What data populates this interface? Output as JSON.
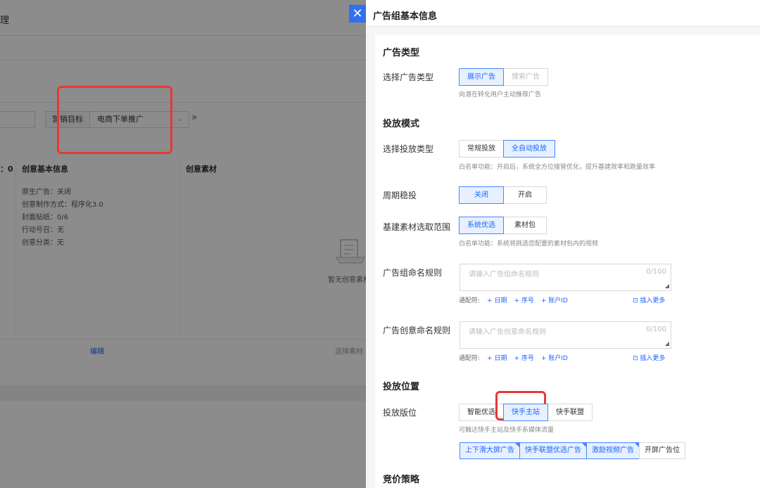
{
  "background": {
    "title_fragment": "理",
    "filter": {
      "label": "营销目标",
      "value": "电商下单推广"
    },
    "more_icon": "double-chevron-right-icon",
    "count_fragment": "：0",
    "col_basic": "创意基本信息",
    "col_material": "创意素材",
    "properties": [
      "原生广告：关闭",
      "创意制作方式：程序化3.0",
      "封面贴纸：0/6",
      "行动号召：无",
      "创意分类：无"
    ],
    "empty_text": "暂无创意素材",
    "edit_link": "编辑",
    "choose_link": "选择素材"
  },
  "drawer": {
    "title": "广告组基本信息",
    "close_icon": "close-icon",
    "sections": {
      "ad_type": {
        "title": "广告类型",
        "label": "选择广告类型",
        "options": [
          "展示广告",
          "搜索广告"
        ],
        "hint": "向潜在转化用户主动推荐广告"
      },
      "mode": {
        "title": "投放模式",
        "label": "选择投放类型",
        "options": [
          "常规投放",
          "全自动投放"
        ],
        "hint": "白名单功能：开启后，系统全方位接管优化，提升基建效率和跑量效率"
      },
      "cycle": {
        "label": "周期稳投",
        "options": [
          "关闭",
          "开启"
        ]
      },
      "material": {
        "label": "基建素材选取范围",
        "options": [
          "系统优选",
          "素材包"
        ],
        "hint": "白名单功能：系统将挑选您配置的素材包内的视频"
      },
      "group_name": {
        "label": "广告组命名规则",
        "placeholder": "请输入广告组命名规则",
        "count": "0/100",
        "macro_label": "通配符:",
        "macros": [
          "+ 日期",
          "+ 序号",
          "+ 账户ID"
        ],
        "insert_more": "插入更多"
      },
      "creative_name": {
        "label": "广告创意命名规则",
        "placeholder": "请输入广告创意命名规则",
        "count": "0/100",
        "macro_label": "通配符:",
        "macros": [
          "+ 日期",
          "+ 序号",
          "+ 账户ID"
        ],
        "insert_more": "插入更多"
      },
      "placement": {
        "title": "投放位置",
        "label": "投放版位",
        "options": [
          "智能优选",
          "快手主站",
          "快手联盟"
        ],
        "hint": "可触达快手主站及快手系媒体流量",
        "tags": [
          "上下滑大屏广告",
          "快手联盟优选广告",
          "激励视频广告",
          "开屏广告位"
        ]
      },
      "bidding": {
        "title": "竞价策略"
      }
    }
  },
  "colors": {
    "primary": "#1a66ff",
    "active_bg": "#e6f0ff",
    "highlight": "#e53935",
    "close_bg": "#2f6ff2"
  }
}
